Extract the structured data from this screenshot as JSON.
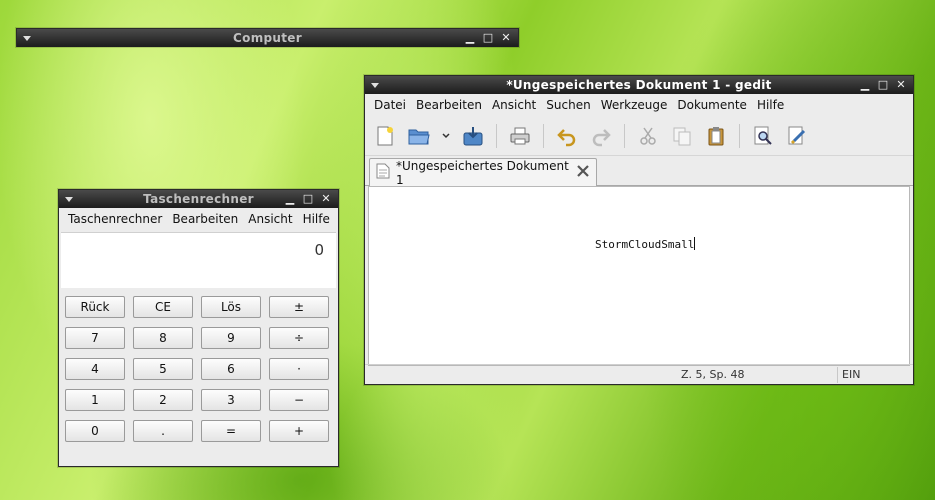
{
  "computer_window": {
    "title": "Computer"
  },
  "calculator": {
    "title": "Taschenrechner",
    "menu": [
      "Taschenrechner",
      "Bearbeiten",
      "Ansicht",
      "Hilfe"
    ],
    "display": "0",
    "keys": [
      "Rück",
      "CE",
      "Lös",
      "±",
      "7",
      "8",
      "9",
      "÷",
      "4",
      "5",
      "6",
      "·",
      "1",
      "2",
      "3",
      "−",
      "0",
      ".",
      "=",
      "+"
    ]
  },
  "gedit": {
    "title": "*Ungespeichertes Dokument 1 - gedit",
    "menu": [
      "Datei",
      "Bearbeiten",
      "Ansicht",
      "Suchen",
      "Werkzeuge",
      "Dokumente",
      "Hilfe"
    ],
    "tab_label": "*Ungespeichertes Dokument 1",
    "content": "StormCloudSmall",
    "status_position": "Z. 5, Sp. 48",
    "status_mode": "EIN"
  },
  "window_controls": {
    "minimize": "▁",
    "maximize": "□",
    "close": "✕"
  }
}
